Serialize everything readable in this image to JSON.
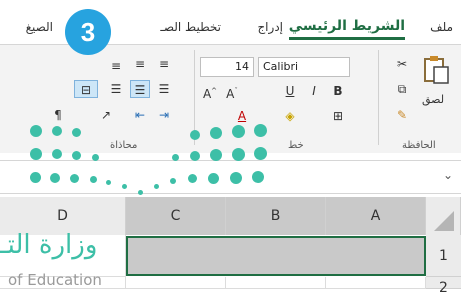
{
  "ribbon_tabs": [
    {
      "label": "ملف"
    },
    {
      "label": "الشريط الرئيسي",
      "active": true
    },
    {
      "label": "إدراج"
    },
    {
      "label": "تخطيط الصـ"
    },
    {
      "label": "الصيغ"
    }
  ],
  "font": {
    "name": "Calibri",
    "size": "14"
  },
  "clipboard": {
    "paste_label": "لصق",
    "group_label": "الحافظة"
  },
  "groups": {
    "font_label": "خط",
    "alignment_label": "محاذاة"
  },
  "step_badge": "3",
  "columns": [
    "D",
    "C",
    "B",
    "A"
  ],
  "rows": [
    "1",
    "2"
  ],
  "logo": {
    "line1": "وزارة التـ",
    "line2": "of Education"
  },
  "colors": {
    "accent_green": "#1f6e43",
    "badge_blue": "#27a3df",
    "logo_teal": "#3dbfa7",
    "selection_grey": "#c9c9c9"
  }
}
